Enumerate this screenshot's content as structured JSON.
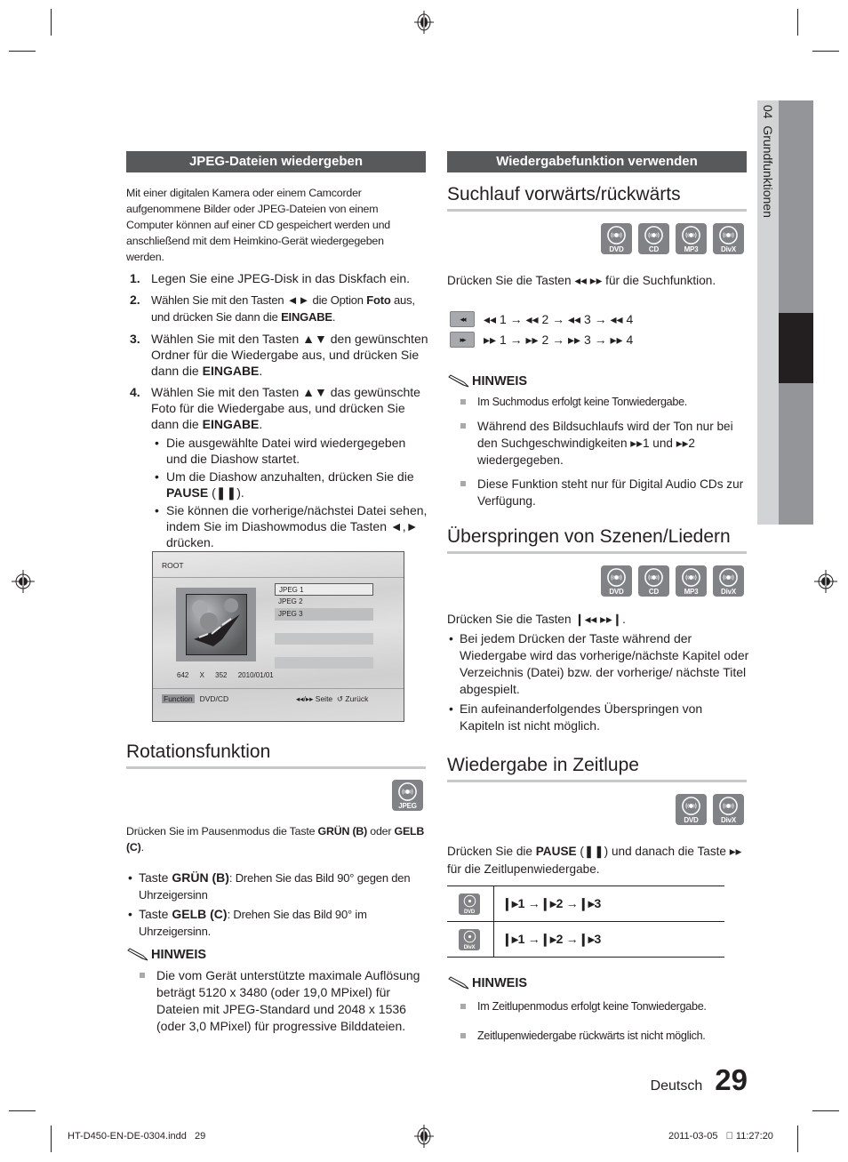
{
  "side_tab": {
    "chapter": "04",
    "title": "Grundfunktionen"
  },
  "left": {
    "banner": "JPEG-Dateien wiedergeben",
    "intro": "Mit einer digitalen Kamera oder einem Camcorder aufgenommene Bilder oder JPEG-Dateien von einem Computer können auf einer CD gespeichert werden und anschließend mit dem Heimkino-Gerät wiedergegeben werden.",
    "steps": [
      {
        "num": "1.",
        "text": "Legen Sie eine JPEG-Disk in das Diskfach ein."
      },
      {
        "num": "2.",
        "pre": "Wählen Sie mit den Tasten ◄► die Option ",
        "bold1": "Foto",
        "mid": " aus, und drücken Sie dann die ",
        "bold2": "EINGABE",
        "post": "."
      },
      {
        "num": "3.",
        "pre": "Wählen Sie mit den Tasten ▲▼ den gewünschten Ordner für die Wiedergabe aus, und drücken Sie dann die ",
        "bold": "EINGABE",
        "post": "."
      },
      {
        "num": "4.",
        "pre": "Wählen Sie mit den Tasten ▲▼ das gewünschte Foto für die Wiedergabe aus, und drücken Sie dann die ",
        "bold": "EINGABE",
        "post": "."
      }
    ],
    "step4_bullets": [
      {
        "text": "Die ausgewählte Datei wird wiedergegeben und die Diashow startet."
      },
      {
        "pre": "Um die Diashow anzuhalten, drücken Sie die ",
        "bold": "PAUSE",
        "post": " (❚❚)."
      },
      {
        "text": "Sie können die vorherige/nächstei Datei sehen, indem Sie im Diashowmodus die Tasten ◄,► drücken."
      }
    ],
    "screen": {
      "root": "ROOT",
      "files": [
        "JPEG 1",
        "JPEG 2",
        "JPEG 3"
      ],
      "resolution": "642 X 352",
      "date": "2010/01/01",
      "function_label": "Function",
      "source": "DVD/CD",
      "page_hint": "◂◂/▸▸ Seite",
      "back_hint": "↺ Zurück"
    },
    "rotation": {
      "title": "Rotationsfunktion",
      "disc_label": "JPEG",
      "intro_pre": "Drücken Sie im Pausenmodus die Taste ",
      "intro_b1": "GRÜN (B)",
      "intro_mid": " oder ",
      "intro_b2": "GELB  (C)",
      "intro_post": ".",
      "bullets": [
        {
          "pre": "Taste ",
          "bold": "GRÜN (B)",
          "post": ": Drehen Sie das Bild 90° gegen den Uhrzeigersinn"
        },
        {
          "pre": "Taste ",
          "bold": "GELB (C)",
          "post": ": Drehen Sie das Bild 90° im Uhrzeigersinn."
        }
      ],
      "note_title": "HINWEIS",
      "notes": [
        "Die vom Gerät unterstützte maximale Auflösung beträgt 5120 x 3480 (oder 19,0 MPixel) für Dateien mit JPEG-Standard und 2048 x 1536 (oder 3,0 MPixel) für progressive Bilddateien."
      ]
    }
  },
  "right": {
    "banner": "Wiedergabefunktion verwenden",
    "search": {
      "title": "Suchlauf vorwärts/rückwärts",
      "discs": [
        "DVD",
        "CD",
        "MP3",
        "DivX"
      ],
      "instruction": "Drücken Sie die Tasten ◂◂ ▸▸ für die Suchfunktion.",
      "rows": [
        {
          "key": "◂◂",
          "sequence": "◂◂ 1 → ◂◂ 2 → ◂◂ 3 → ◂◂ 4"
        },
        {
          "key": "▸▸",
          "sequence": "▸▸ 1 → ▸▸ 2 → ▸▸ 3 → ▸▸ 4"
        }
      ],
      "note_title": "HINWEIS",
      "notes": [
        "Im Suchmodus erfolgt keine Tonwiedergabe.",
        "Während des Bildsuchlaufs wird der Ton nur bei den Suchgeschwindigkeiten ▸▸1 und ▸▸2 wiedergegeben.",
        "Diese Funktion steht nur für Digital Audio CDs zur Verfügung."
      ]
    },
    "skip": {
      "title": "Überspringen von Szenen/Liedern",
      "discs": [
        "DVD",
        "CD",
        "MP3",
        "DivX"
      ],
      "instruction": "Drücken Sie die Tasten ❙◂◂ ▸▸❙.",
      "bullets": [
        "Bei jedem Drücken der Taste während der Wiedergabe wird das vorherige/nächste Kapitel oder Verzeichnis (Datei) bzw. der vorherige/ nächste Titel abgespielt.",
        "Ein aufeinanderfolgendes Überspringen von Kapiteln ist nicht möglich."
      ]
    },
    "slow": {
      "title": "Wiedergabe in Zeitlupe",
      "discs": [
        "DVD",
        "DivX"
      ],
      "instr_pre": "Drücken Sie die ",
      "instr_bold": "PAUSE",
      "instr_post": " (❚❚) und danach die Taste ▸▸ für die Zeitlupenwiedergabe.",
      "table": [
        {
          "disc": "DVD",
          "sequence": "❙▸1 →❙▸2 →❙▸3"
        },
        {
          "disc": "DivX",
          "sequence": "❙▸1 →❙▸2 →❙▸3"
        }
      ],
      "note_title": "HINWEIS",
      "notes": [
        "Im Zeitlupenmodus erfolgt keine Tonwiedergabe.",
        "Zeitlupenwiedergabe rückwärts ist nicht möglich."
      ]
    }
  },
  "footer": {
    "language": "Deutsch",
    "page_number": "29"
  },
  "slug": {
    "file": "HT-D450-EN-DE-0304.indd   29",
    "datetime": "2011-03-05   ￿ 11:27:20"
  }
}
